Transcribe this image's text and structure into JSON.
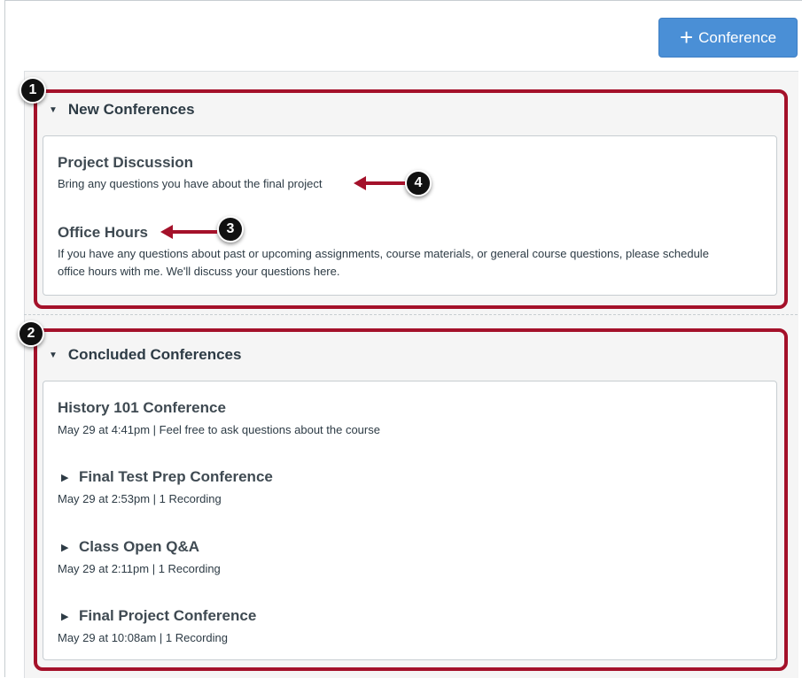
{
  "toolbar": {
    "add_button_label": "Conference",
    "add_icon": "plus-icon"
  },
  "new_section": {
    "heading": "New Conferences",
    "items": [
      {
        "title": "Project Discussion",
        "description": "Bring any questions you have about the final project"
      },
      {
        "title": "Office Hours",
        "description": "If you have any questions about past or upcoming assignments, course materials, or general course questions, please schedule office hours with me. We'll discuss your questions here."
      }
    ]
  },
  "concluded_section": {
    "heading": "Concluded Conferences",
    "items": [
      {
        "title": "History 101 Conference",
        "meta": "May 29 at 4:41pm  |  Feel free to ask questions about the course"
      },
      {
        "title": "Final Test Prep Conference",
        "meta": "May 29 at 2:53pm  |  1 Recording"
      },
      {
        "title": "Class Open Q&A",
        "meta": "May 29 at 2:11pm  |  1 Recording"
      },
      {
        "title": "Final Project Conference",
        "meta": "May 29 at 10:08am  |  1 Recording"
      }
    ]
  },
  "annotations": {
    "badge1": "1",
    "badge2": "2",
    "badge3": "3",
    "badge4": "4"
  },
  "colors": {
    "accent": "#4a8fd6",
    "highlight": "#a4112a",
    "badge": "#111111"
  }
}
